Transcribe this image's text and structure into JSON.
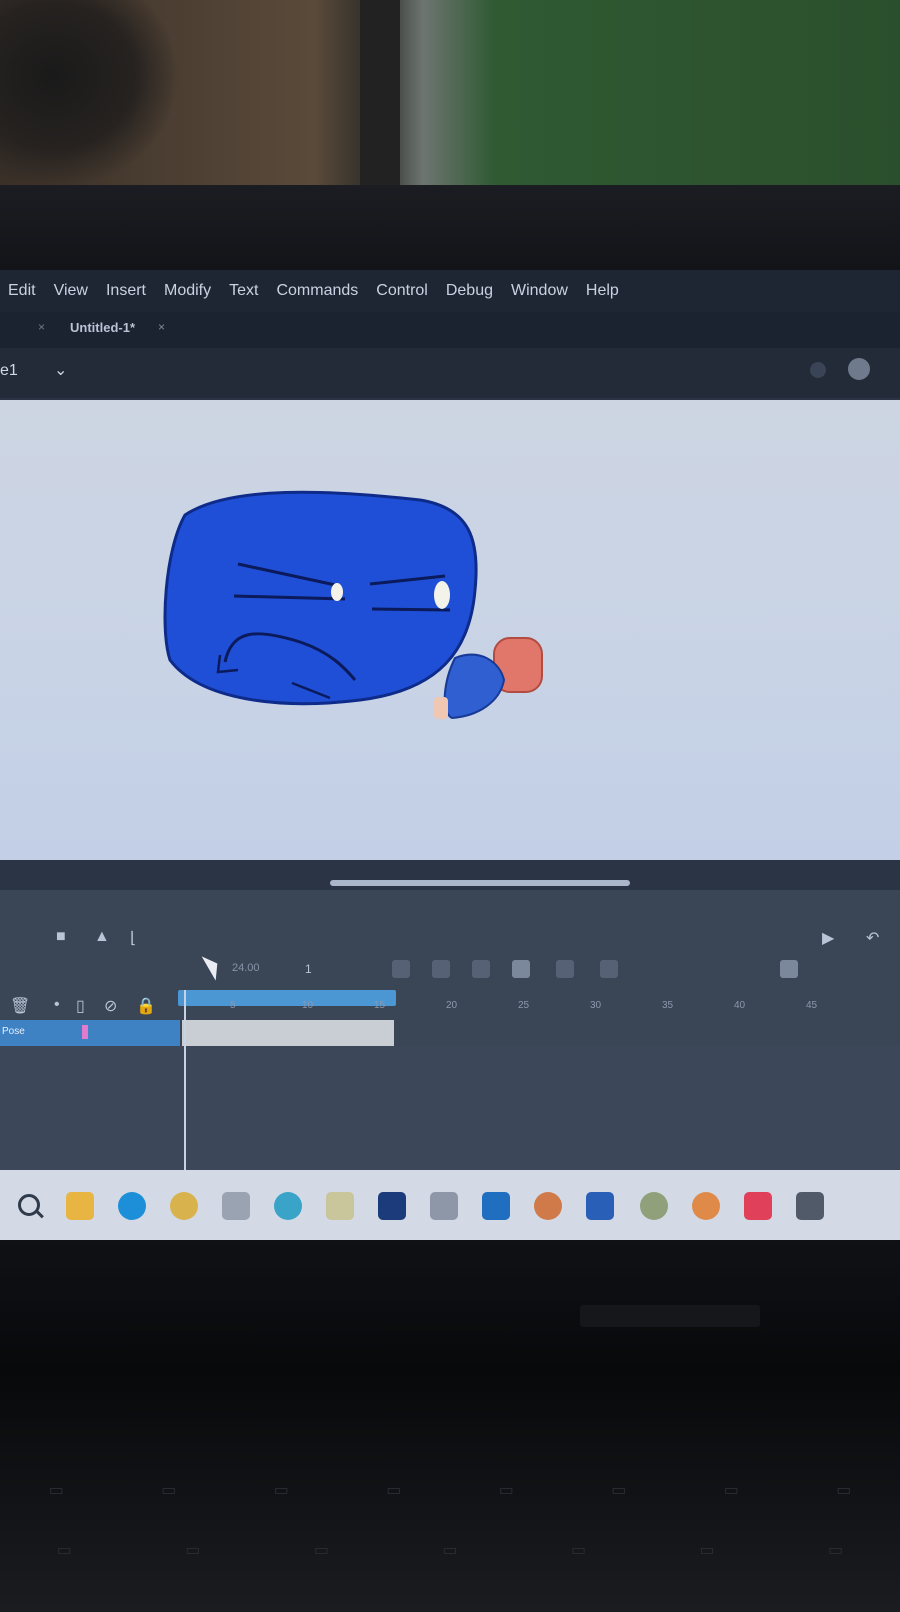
{
  "menubar": {
    "items": [
      "Edit",
      "View",
      "Insert",
      "Modify",
      "Text",
      "Commands",
      "Control",
      "Debug",
      "Window",
      "Help"
    ]
  },
  "document": {
    "tab_title": "Untitled-1*"
  },
  "scene": {
    "label": "e1"
  },
  "timeline": {
    "fps": "24.00",
    "current_frame": "1",
    "layer_name": "Pose",
    "ruler_ticks": [
      "5",
      "10",
      "15",
      "20",
      "25",
      "30",
      "35",
      "40",
      "45"
    ]
  },
  "taskbar": {
    "icons": [
      "search-icon",
      "file-explorer-icon",
      "edge-icon",
      "app-icon-1",
      "app-icon-2",
      "app-icon-3",
      "app-icon-4",
      "animate-icon",
      "app-icon-5",
      "app-icon-6",
      "app-icon-7",
      "app-icon-8",
      "app-icon-9",
      "app-icon-10",
      "app-icon-11",
      "app-icon-12"
    ]
  },
  "colors": {
    "stage_bg": "#c8d3e6",
    "character_body": "#1f4fd6",
    "menubar_bg": "#1f2633",
    "timeline_accent": "#4b97d4"
  }
}
